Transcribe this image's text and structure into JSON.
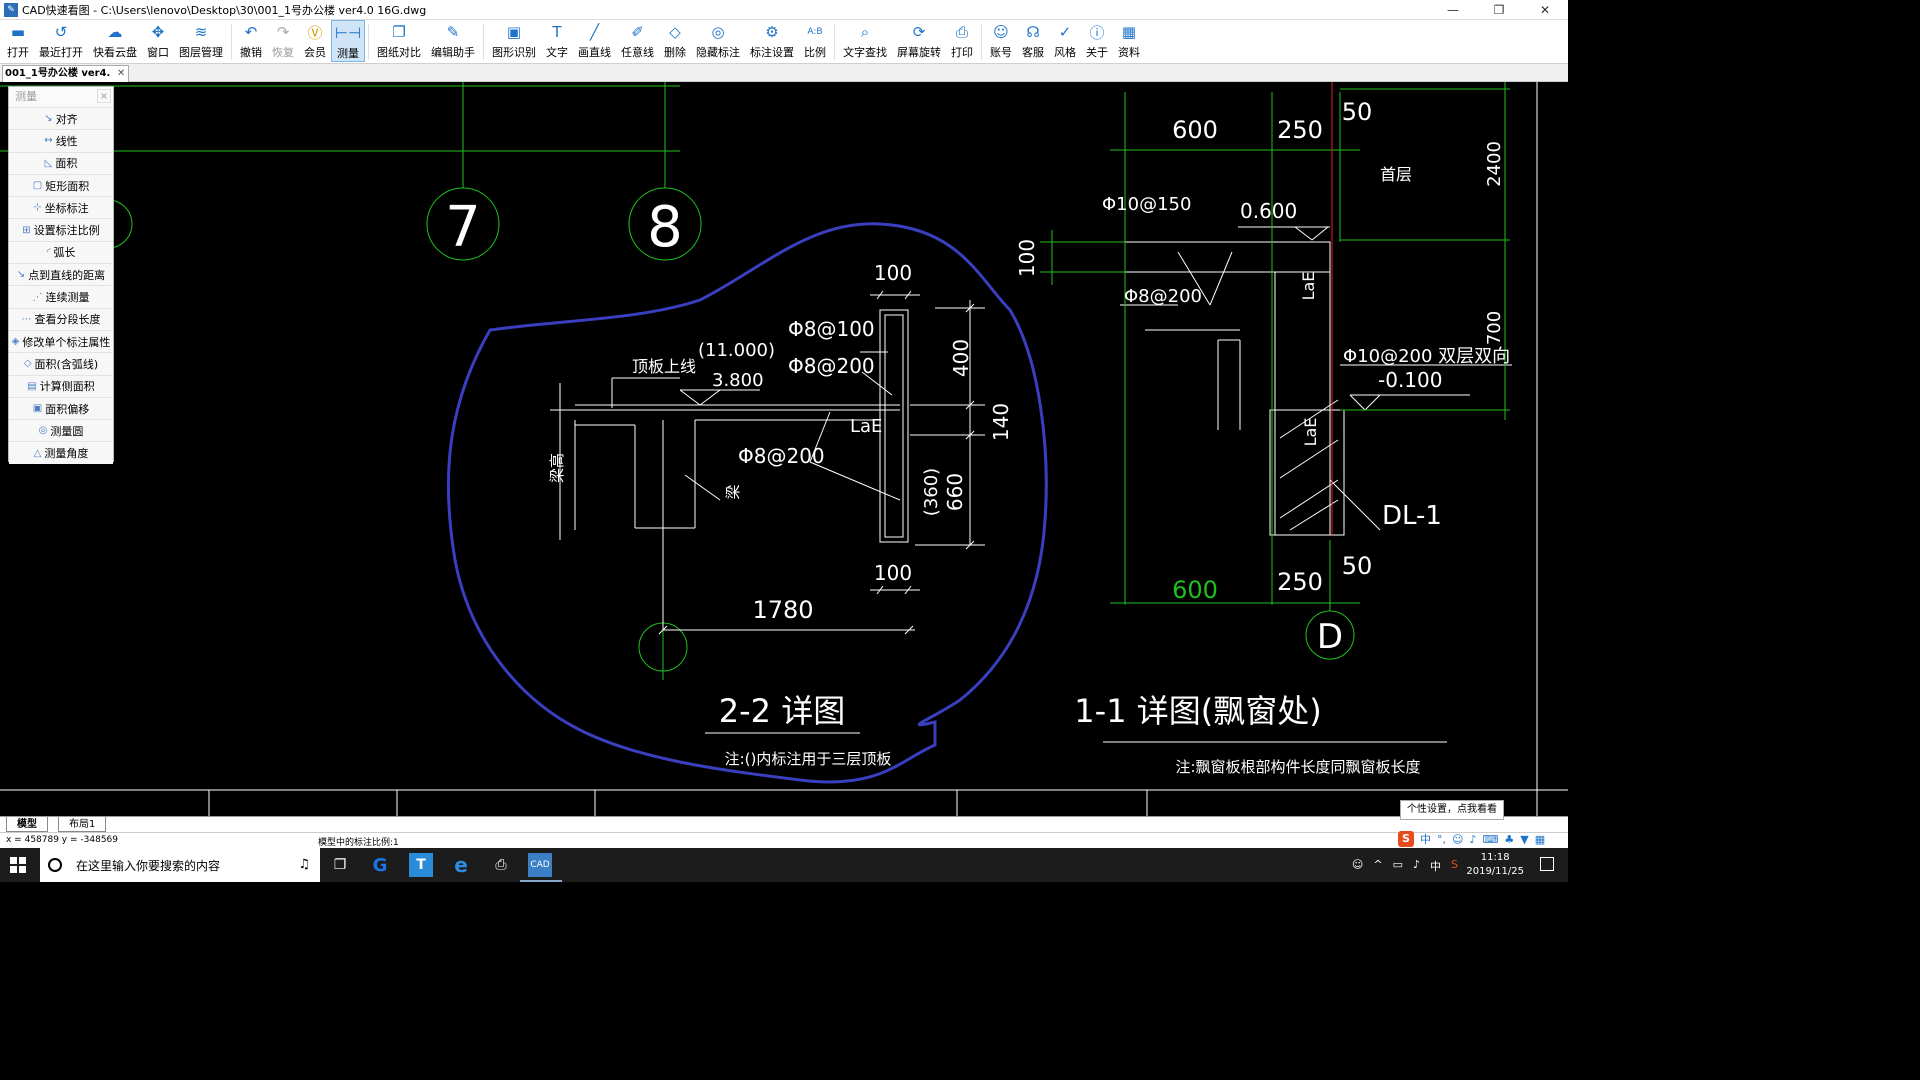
{
  "window": {
    "title": "CAD快速看图 - C:\\Users\\lenovo\\Desktop\\30\\001_1号办公楼 ver4.0 16G.dwg",
    "minimize": "—",
    "maximize": "❐",
    "close": "✕"
  },
  "toolbar": {
    "items": [
      {
        "label": "打开",
        "icon": "open-folder-icon",
        "glyph": "▬"
      },
      {
        "label": "最近打开",
        "icon": "recent-icon",
        "glyph": "↺"
      },
      {
        "label": "快看云盘",
        "icon": "cloud-icon",
        "glyph": "☁"
      },
      {
        "label": "窗口",
        "icon": "window-icon",
        "glyph": "✥"
      },
      {
        "label": "图层管理",
        "icon": "layers-icon",
        "glyph": "≋"
      },
      {
        "label": "撤销",
        "icon": "undo-icon",
        "glyph": "↶"
      },
      {
        "label": "恢复",
        "icon": "redo-icon",
        "glyph": "↷"
      },
      {
        "label": "会员",
        "icon": "vip-icon",
        "glyph": "Ⓥ"
      },
      {
        "label": "测量",
        "icon": "measure-icon",
        "glyph": "⊢⊣"
      },
      {
        "label": "图纸对比",
        "icon": "compare-icon",
        "glyph": "❐"
      },
      {
        "label": "编辑助手",
        "icon": "edit-assistant-icon",
        "glyph": "✎"
      },
      {
        "label": "图形识别",
        "icon": "shape-recognize-icon",
        "glyph": "▣"
      },
      {
        "label": "文字",
        "icon": "text-icon",
        "glyph": "T"
      },
      {
        "label": "画直线",
        "icon": "line-icon",
        "glyph": "╱"
      },
      {
        "label": "任意线",
        "icon": "freehand-icon",
        "glyph": "✐"
      },
      {
        "label": "删除",
        "icon": "eraser-icon",
        "glyph": "◇"
      },
      {
        "label": "隐藏标注",
        "icon": "hide-annotation-icon",
        "glyph": "◎"
      },
      {
        "label": "标注设置",
        "icon": "annotation-settings-icon",
        "glyph": "⚙"
      },
      {
        "label": "比例",
        "icon": "scale-icon",
        "glyph": "A:B"
      },
      {
        "label": "文字查找",
        "icon": "text-search-icon",
        "glyph": "⌕"
      },
      {
        "label": "屏幕旋转",
        "icon": "rotate-screen-icon",
        "glyph": "⟳"
      },
      {
        "label": "打印",
        "icon": "print-icon",
        "glyph": "⎙"
      },
      {
        "label": "账号",
        "icon": "account-icon",
        "glyph": "☺"
      },
      {
        "label": "客服",
        "icon": "support-icon",
        "glyph": "☊"
      },
      {
        "label": "风格",
        "icon": "style-icon",
        "glyph": "✓"
      },
      {
        "label": "关于",
        "icon": "about-icon",
        "glyph": "ⓘ"
      },
      {
        "label": "资料",
        "icon": "resources-icon",
        "glyph": "▦"
      }
    ]
  },
  "doc_tab": {
    "label": "001_1号办公楼 ver4.",
    "close": "✕"
  },
  "measure_panel": {
    "title": "测量",
    "close": "×",
    "items": [
      {
        "label": "对齐",
        "glyph": "↘"
      },
      {
        "label": "线性",
        "glyph": "↔"
      },
      {
        "label": "面积",
        "glyph": "◺"
      },
      {
        "label": "矩形面积",
        "glyph": "▢"
      },
      {
        "label": "坐标标注",
        "glyph": "⊹"
      },
      {
        "label": "设置标注比例",
        "glyph": "⊞"
      },
      {
        "label": "弧长",
        "glyph": "◜"
      },
      {
        "label": "点到直线的距离",
        "glyph": "↘"
      },
      {
        "label": "连续测量",
        "glyph": "⋰"
      },
      {
        "label": "查看分段长度",
        "glyph": "⋯"
      },
      {
        "label": "修改单个标注属性",
        "glyph": "◈"
      },
      {
        "label": "面积(含弧线)",
        "glyph": "◇"
      },
      {
        "label": "计算侧面积",
        "glyph": "▤"
      },
      {
        "label": "面积偏移",
        "glyph": "▣"
      },
      {
        "label": "测量圆",
        "glyph": "◎"
      },
      {
        "label": "测量角度",
        "glyph": "△"
      }
    ]
  },
  "drawing": {
    "axis_7": "7",
    "axis_8": "8",
    "axis_D": "D",
    "d22": {
      "dim_100_top": "100",
      "rebar_1": "Φ8@100",
      "rebar_2": "Φ8@200",
      "rebar_3": "Φ8@200",
      "level_paren": "(11.000)",
      "level": "3.800",
      "roof_label": "顶板上线",
      "dim_400": "400",
      "dim_140": "140",
      "dim_360": "(360)",
      "dim_660": "660",
      "lae": "LaE",
      "beam_height": "梁高",
      "beam": "梁",
      "dim_100_bottom": "100",
      "dim_1780": "1780",
      "title": "2-2 详图",
      "note": "注:()内标注用于三层顶板"
    },
    "d11": {
      "dim_600_top": "600",
      "dim_250_top": "250",
      "dim_50_top": "50",
      "dim_2400": "2400",
      "floor": "首层",
      "rebar_1": "Φ10@150",
      "level_1": "0.600",
      "dim_100": "100",
      "rebar_2": "Φ8@200",
      "lae_1": "LaE",
      "dim_700": "700",
      "rebar_3": "Φ10@200 双层双向",
      "level_2": "-0.100",
      "lae_2": "LaE",
      "dl": "DL-1",
      "dim_600_bottom": "600",
      "dim_250_bottom": "250",
      "dim_50_bottom": "50",
      "title": "1-1 详图(飘窗处)",
      "note": "注:飘窗板根部构件长度同飘窗板长度"
    }
  },
  "layout_tabs": {
    "model": "模型",
    "layout1": "布局1"
  },
  "status": {
    "coords": "x = 458789  y = -348569",
    "scale": "模型中的标注比例:1"
  },
  "tooltip": "个性设置，点我看看",
  "ime": {
    "s_logo": "S",
    "lang": "中",
    "punct": "°,"
  },
  "taskbar": {
    "search_placeholder": "在这里输入你要搜索的内容",
    "tray_lang": "中",
    "time": "11:18",
    "date": "2019/11/25"
  },
  "colors": {
    "green": "#1fbf1f",
    "white": "#ffffff",
    "blue_sketch": "#3a3fc0",
    "red": "#e02020",
    "accent": "#1e73c8"
  }
}
